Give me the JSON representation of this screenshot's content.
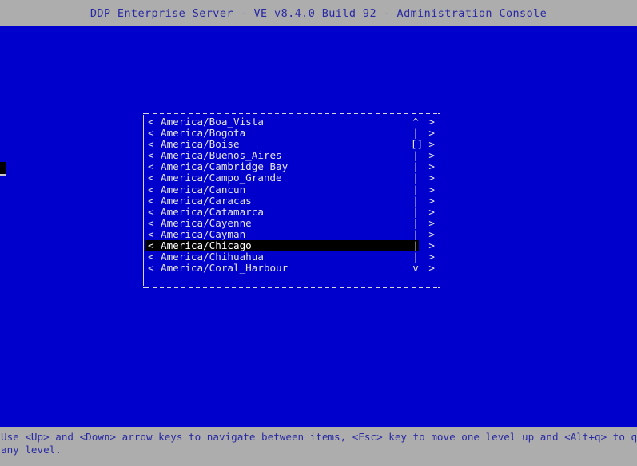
{
  "window": {
    "title": "DDP Enterprise Server - VE v8.4.0 Build 92 - Administration Console",
    "colors": {
      "titlebar_background": "#adadad",
      "titlebar_text": "#2929a3",
      "screen_background": "#0000cc",
      "screen_text": "#e6e6e6",
      "selection_background": "#000000",
      "selection_text": "#ffffff",
      "border": "#d8d8d8",
      "statusbar_background": "#adadad",
      "statusbar_text": "#2929a3"
    }
  },
  "menu": {
    "left_marker": "<",
    "right_marker": ">",
    "scroll_up_glyph": "^",
    "scroll_down_glyph": "v",
    "scroll_track_glyph": "|",
    "scroll_thumb_glyph": "[]",
    "selected_index": 11,
    "items": [
      {
        "label": "America/Boa_Vista",
        "scroll": "^",
        "selected": false
      },
      {
        "label": "America/Bogota",
        "scroll": "|",
        "selected": false
      },
      {
        "label": "America/Boise",
        "scroll": "[]",
        "selected": false
      },
      {
        "label": "America/Buenos_Aires",
        "scroll": "|",
        "selected": false
      },
      {
        "label": "America/Cambridge_Bay",
        "scroll": "|",
        "selected": false
      },
      {
        "label": "America/Campo_Grande",
        "scroll": "|",
        "selected": false
      },
      {
        "label": "America/Cancun",
        "scroll": "|",
        "selected": false
      },
      {
        "label": "America/Caracas",
        "scroll": "|",
        "selected": false
      },
      {
        "label": "America/Catamarca",
        "scroll": "|",
        "selected": false
      },
      {
        "label": "America/Cayenne",
        "scroll": "|",
        "selected": false
      },
      {
        "label": "America/Cayman",
        "scroll": "|",
        "selected": false
      },
      {
        "label": "America/Chicago",
        "scroll": "|",
        "selected": true
      },
      {
        "label": "America/Chihuahua",
        "scroll": "|",
        "selected": false
      },
      {
        "label": "America/Coral_Harbour",
        "scroll": "v",
        "selected": false
      }
    ]
  },
  "statusbar": {
    "line1": "Use <Up> and <Down> arrow keys to navigate between items, <Esc> key to move one level up and <Alt+q> to quit at",
    "line2": "any level."
  }
}
